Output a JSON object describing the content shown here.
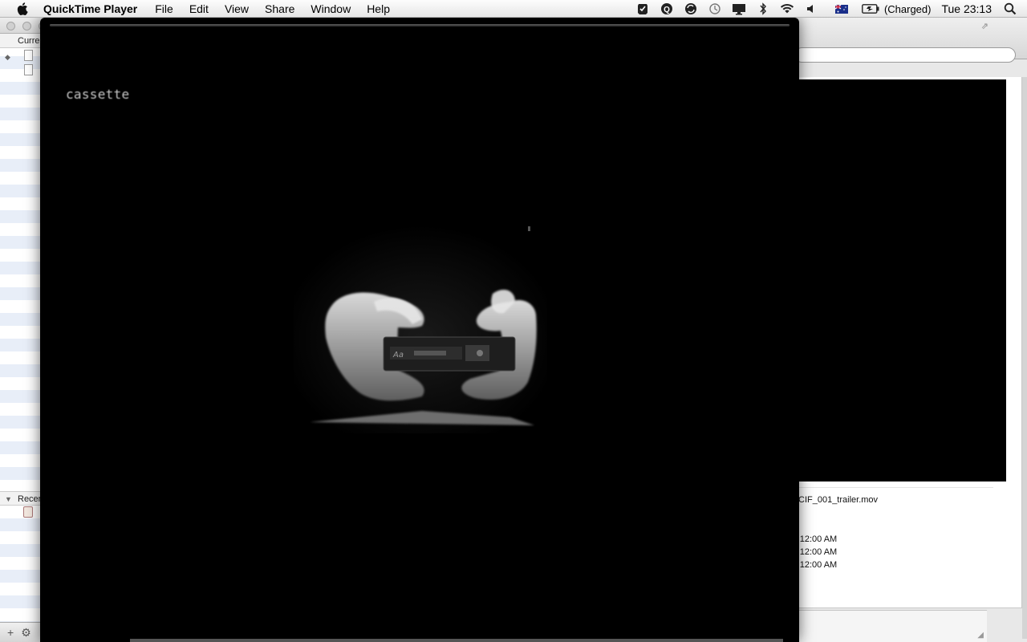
{
  "menubar": {
    "app_name": "QuickTime Player",
    "items": [
      "File",
      "Edit",
      "View",
      "Share",
      "Window",
      "Help"
    ],
    "battery_status": "(Charged)",
    "clock": "Tue 23:13",
    "status_icons": [
      "checkmark-shield-icon",
      "q-icon",
      "sync-icon",
      "time-machine-icon",
      "display-icon",
      "bluetooth-icon",
      "wifi-icon",
      "volume-icon",
      "australia-flag-icon",
      "battery-icon",
      "spotlight-search-icon"
    ]
  },
  "left_window": {
    "section_current": "Curre",
    "section_recent": "Recen"
  },
  "right_window": {
    "filename": "CIF_001_trailer.mov",
    "dates": [
      "12:00 AM",
      "12:00 AM",
      "12:00 AM"
    ]
  },
  "player": {
    "caption": "cassette"
  }
}
